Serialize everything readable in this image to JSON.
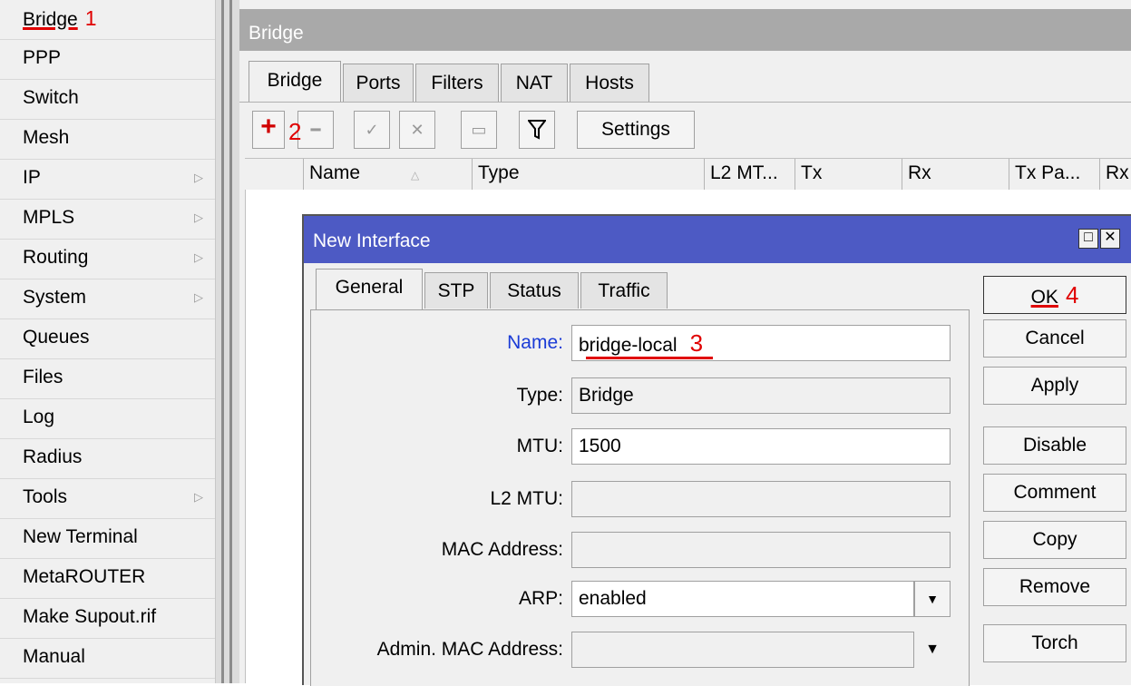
{
  "sidebar": {
    "items": [
      {
        "label": "Bridge",
        "has_submenu": false,
        "annotation": "1"
      },
      {
        "label": "PPP",
        "has_submenu": false
      },
      {
        "label": "Switch",
        "has_submenu": false
      },
      {
        "label": "Mesh",
        "has_submenu": false
      },
      {
        "label": "IP",
        "has_submenu": true
      },
      {
        "label": "MPLS",
        "has_submenu": true
      },
      {
        "label": "Routing",
        "has_submenu": true
      },
      {
        "label": "System",
        "has_submenu": true
      },
      {
        "label": "Queues",
        "has_submenu": false
      },
      {
        "label": "Files",
        "has_submenu": false
      },
      {
        "label": "Log",
        "has_submenu": false
      },
      {
        "label": "Radius",
        "has_submenu": false
      },
      {
        "label": "Tools",
        "has_submenu": true
      },
      {
        "label": "New Terminal",
        "has_submenu": false
      },
      {
        "label": "MetaROUTER",
        "has_submenu": false
      },
      {
        "label": "Make Supout.rif",
        "has_submenu": false
      },
      {
        "label": "Manual",
        "has_submenu": false
      }
    ],
    "submenu_icon": "triangle-right-icon"
  },
  "bridge_window": {
    "title": "Bridge",
    "tabs": [
      "Bridge",
      "Ports",
      "Filters",
      "NAT",
      "Hosts"
    ],
    "active_tab": "Bridge",
    "toolbar": {
      "add_icon": "plus-icon",
      "add_annotation": "2",
      "remove_icon": "minus-icon",
      "enable_icon": "check-icon",
      "disable_icon": "cross-icon",
      "comment_icon": "comment-icon",
      "filter_icon": "filter-icon",
      "settings_label": "Settings"
    },
    "table": {
      "columns": [
        "Name",
        "Type",
        "L2 MT...",
        "Tx",
        "Rx",
        "Tx Pa...",
        "Rx"
      ],
      "rows": []
    }
  },
  "dialog": {
    "title": "New Interface",
    "tabs": [
      "General",
      "STP",
      "Status",
      "Traffic"
    ],
    "active_tab": "General",
    "fields": {
      "name": {
        "label": "Name:",
        "value": "bridge-local",
        "annotation": "3"
      },
      "type": {
        "label": "Type:",
        "value": "Bridge"
      },
      "mtu": {
        "label": "MTU:",
        "value": "1500"
      },
      "l2mtu": {
        "label": "L2 MTU:",
        "value": ""
      },
      "mac": {
        "label": "MAC Address:",
        "value": ""
      },
      "arp": {
        "label": "ARP:",
        "value": "enabled"
      },
      "admin_mac": {
        "label": "Admin. MAC Address:",
        "value": ""
      }
    },
    "buttons": {
      "ok": "OK",
      "ok_annotation": "4",
      "cancel": "Cancel",
      "apply": "Apply",
      "disable": "Disable",
      "comment": "Comment",
      "copy": "Copy",
      "remove": "Remove",
      "torch": "Torch"
    }
  },
  "colors": {
    "dialog_title_bg": "#4d5ac4",
    "annotation": "#e00000",
    "name_label": "#1a3bd6",
    "window_title_bg": "#a9a9a9"
  }
}
